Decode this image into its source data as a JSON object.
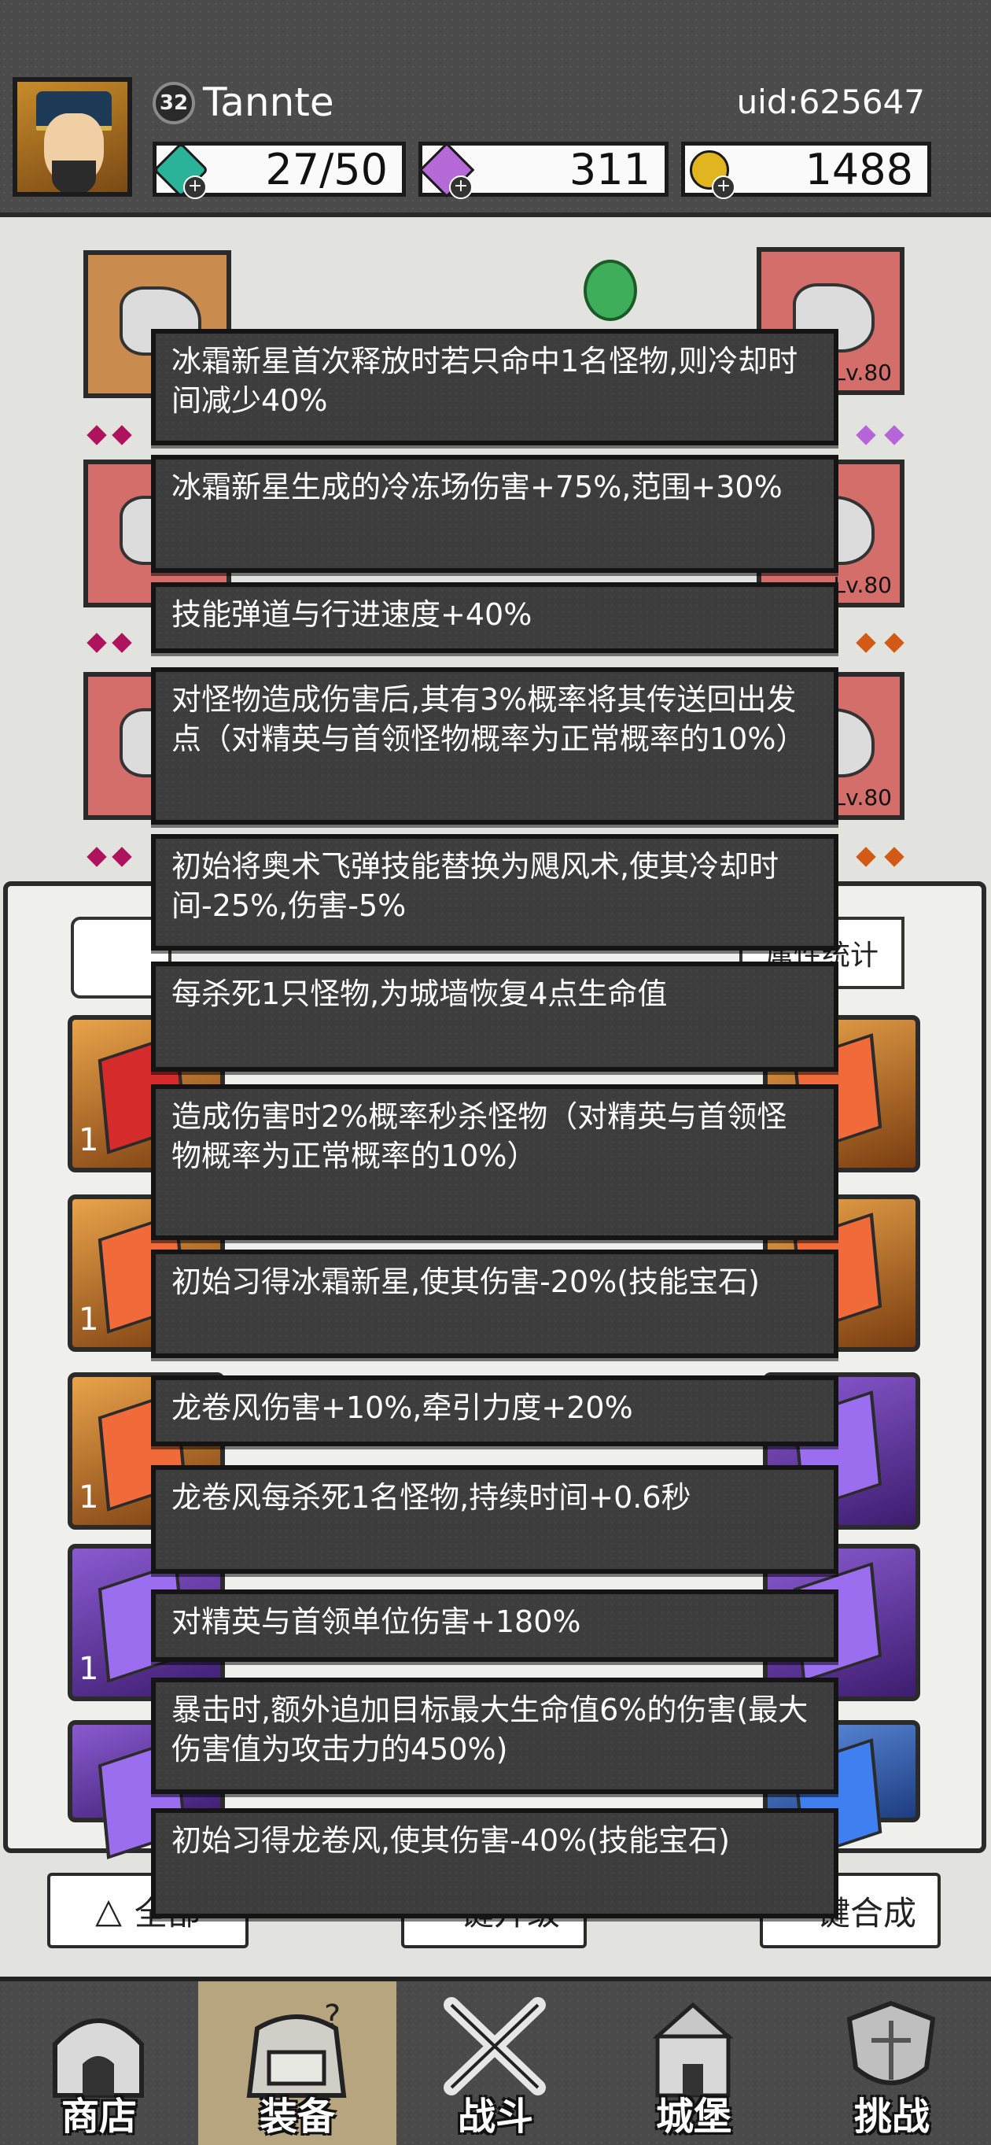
{
  "player": {
    "level": "32",
    "name": "Tannte",
    "uid": "uid:625647"
  },
  "resources": [
    {
      "icon": "energy-gem-icon",
      "value": "27/50",
      "color": "#2bb39a"
    },
    {
      "icon": "purple-diamond-icon",
      "value": "311",
      "color": "#b56ad8"
    },
    {
      "icon": "gold-coin-icon",
      "value": "1488",
      "color": "#e0b520"
    }
  ],
  "equipment_slots": {
    "levels": [
      "Lv.80",
      "Lv.80",
      "Lv.80"
    ]
  },
  "inventory": {
    "stats_button": "属性统计",
    "card_counts": [
      "1",
      "1",
      "1",
      "1"
    ],
    "filter_button": "全部",
    "upgrade_button": "一键升级",
    "merge_button": "一键合成"
  },
  "tooltips": [
    "冰霜新星首次释放时若只命中1名怪物,则冷却时间减少40%",
    "冰霜新星生成的冷冻场伤害+75%,范围+30%",
    "技能弹道与行进速度+40%",
    "对怪物造成伤害后,其有3%概率将其传送回出发点（对精英与首领怪物概率为正常概率的10%）",
    "初始将奥术飞弹技能替换为飓风术,使其冷却时间-25%,伤害-5%",
    "每杀死1只怪物,为城墙恢复4点生命值",
    "造成伤害时2%概率秒杀怪物（对精英与首领怪物概率为正常概率的10%）",
    "初始习得冰霜新星,使其伤害-20%(技能宝石)",
    "龙卷风伤害+10%,牵引力度+20%",
    "龙卷风每杀死1名怪物,持续时间+0.6秒",
    "对精英与首领单位伤害+180%",
    "暴击时,额外追加目标最大生命值6%的伤害(最大伤害值为攻击力的450%)",
    "初始习得龙卷风,使其伤害-40%(技能宝石)"
  ],
  "nav": [
    {
      "label": "商店",
      "icon": "shop-icon",
      "active": false
    },
    {
      "label": "装备",
      "icon": "bag-icon",
      "active": true
    },
    {
      "label": "战斗",
      "icon": "crossed-swords-icon",
      "active": false
    },
    {
      "label": "城堡",
      "icon": "castle-icon",
      "active": false
    },
    {
      "label": "挑战",
      "icon": "shield-icon",
      "active": false
    }
  ]
}
